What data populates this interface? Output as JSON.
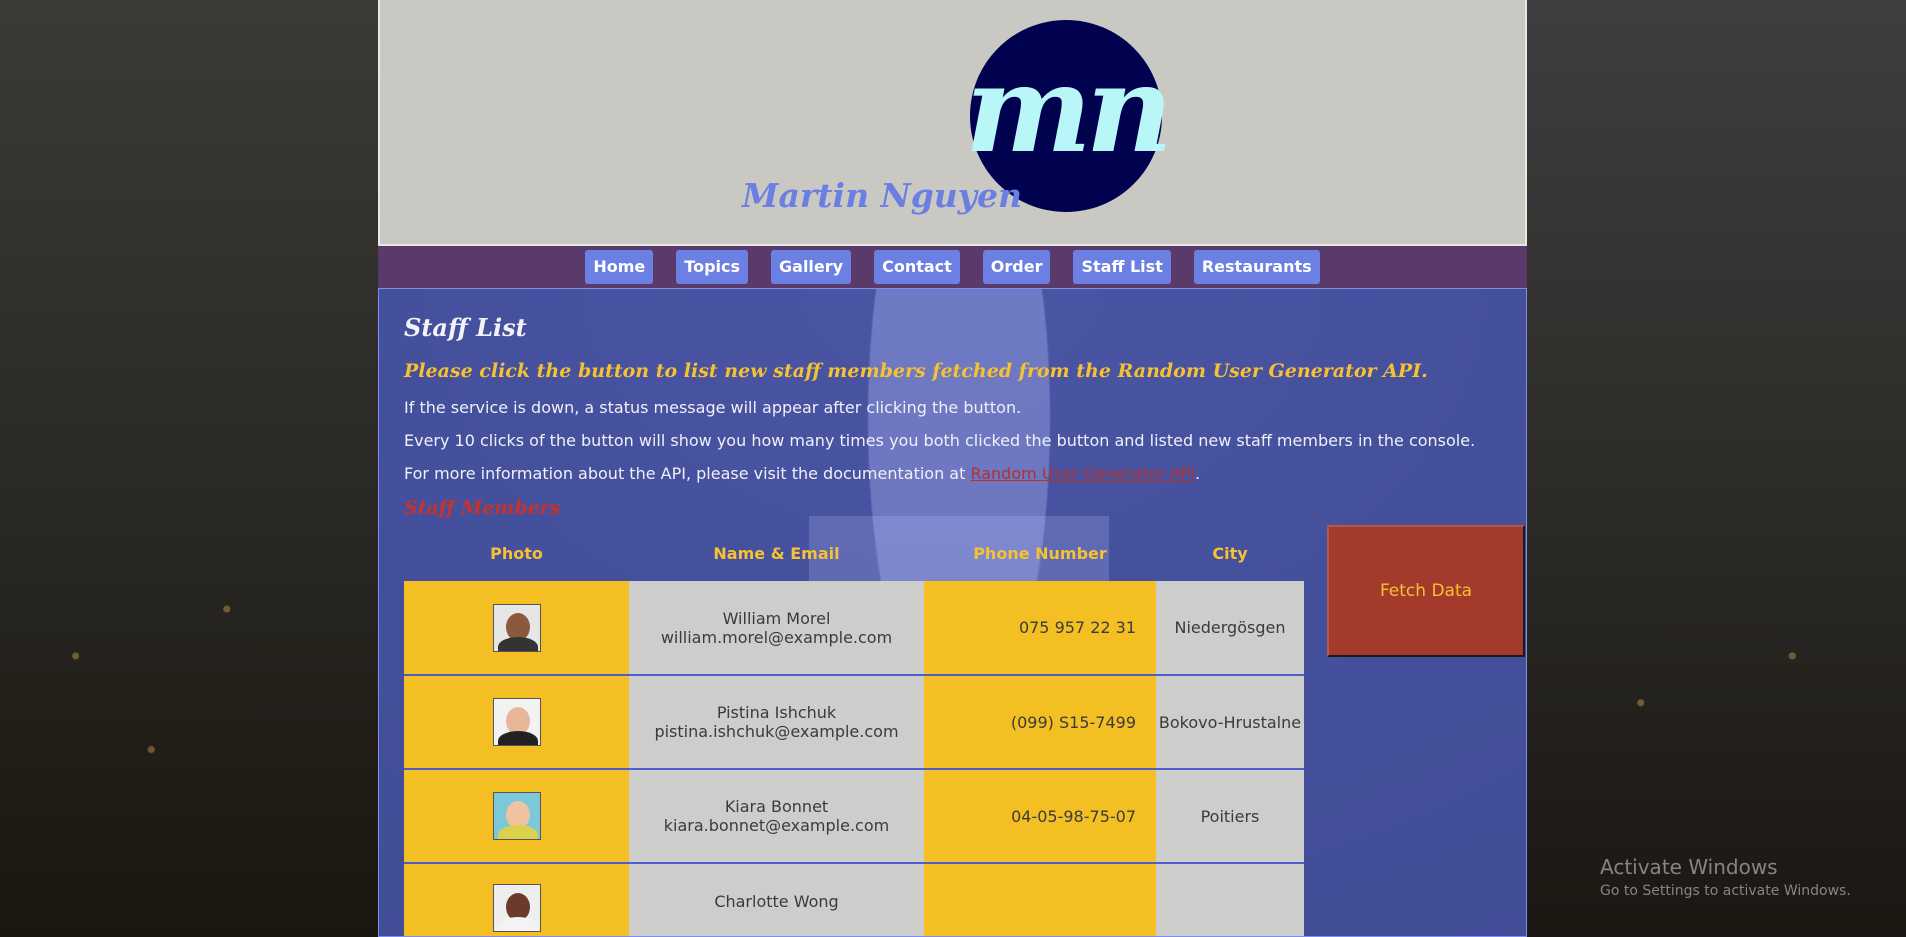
{
  "header": {
    "logo_text": "mn",
    "site_name": "Martin Nguyen"
  },
  "nav": {
    "items": [
      "Home",
      "Topics",
      "Gallery",
      "Contact",
      "Order",
      "Staff List",
      "Restaurants"
    ]
  },
  "main": {
    "title": "Staff List",
    "subtitle": "Please click the button to list new staff members fetched from the Random User Generator API.",
    "info1": "If the service is down, a status message will appear after clicking the button.",
    "info2": "Every 10 clicks of the button will show you how many times you both clicked the button and listed new staff members in the console.",
    "info3_prefix": "For more information about the API, please visit the documentation at ",
    "info3_link": "Random User Generator API",
    "info3_suffix": ".",
    "section_title": "Staff Members",
    "table": {
      "headers": [
        "Photo",
        "Name & Email",
        "Phone Number",
        "City"
      ],
      "rows": [
        {
          "name": "William Morel",
          "email": "william.morel@example.com",
          "phone": "075 957 22 31",
          "city": "Niedergösgen"
        },
        {
          "name": "Pistina Ishchuk",
          "email": "pistina.ishchuk@example.com",
          "phone": "(099) S15-7499",
          "city": "Bokovo-Hrustalne"
        },
        {
          "name": "Kiara Bonnet",
          "email": "kiara.bonnet@example.com",
          "phone": "04-05-98-75-07",
          "city": "Poitiers"
        },
        {
          "name": "Charlotte Wong",
          "email": "",
          "phone": "",
          "city": ""
        }
      ]
    },
    "fetch_button": "Fetch Data"
  },
  "os_watermark": {
    "title": "Activate Windows",
    "subtitle": "Go to Settings to activate Windows."
  },
  "colors": {
    "nav_bg": "#5a3a6a",
    "nav_button": "#6c7fe3",
    "accent_yellow": "#f6c132",
    "accent_red": "#a33a2c",
    "logo_bg": "#01024f"
  }
}
